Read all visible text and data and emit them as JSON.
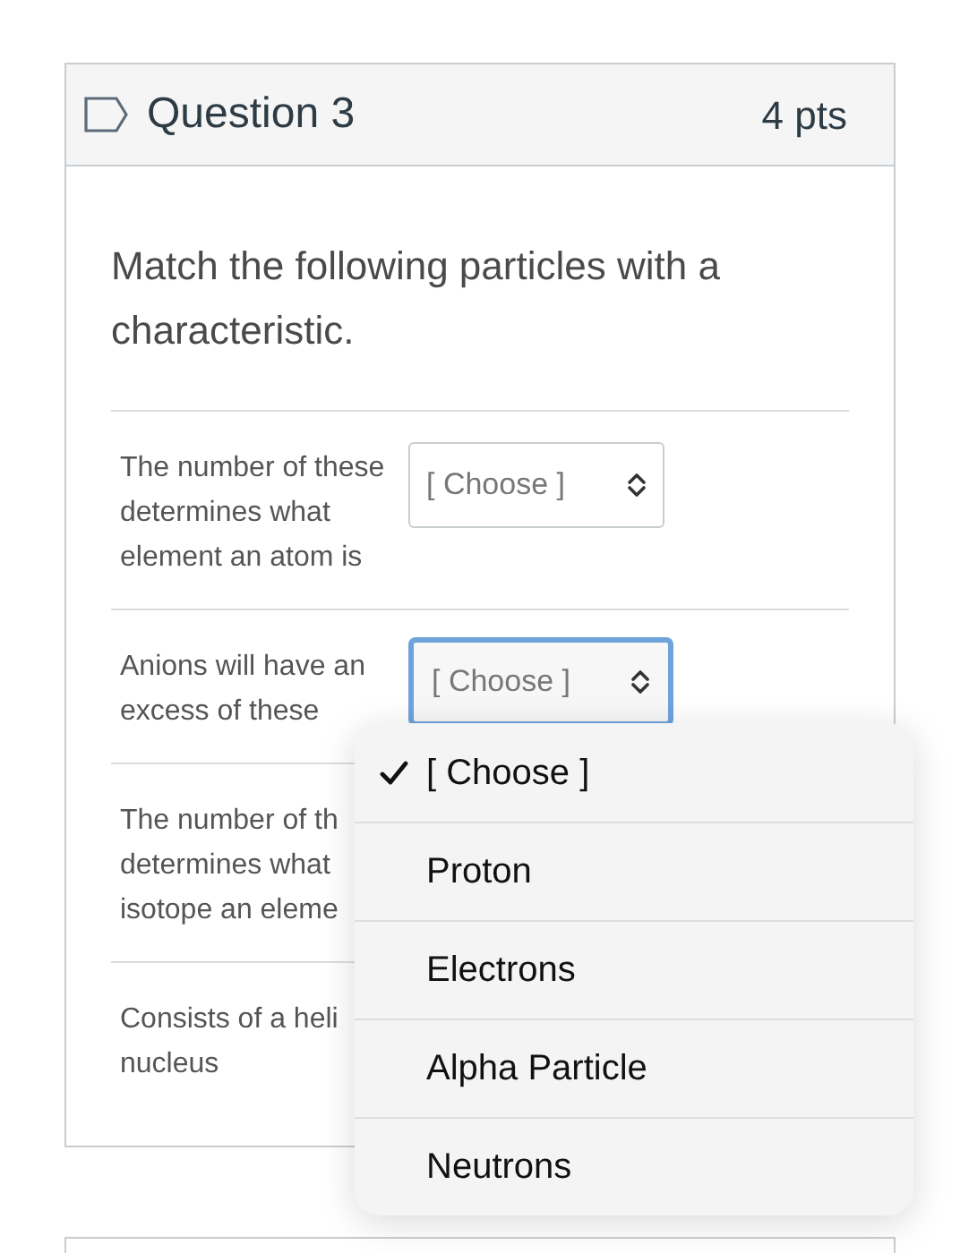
{
  "question": {
    "title": "Question 3",
    "points": "4 pts",
    "prompt": "Match the following particles with a characteristic."
  },
  "rows": [
    {
      "text": "The number of these determines what element an atom is",
      "select": {
        "value": "[ Choose ]",
        "focused": false
      }
    },
    {
      "text": "Anions will have an excess of these",
      "select": {
        "value": "[ Choose ]",
        "focused": true
      }
    },
    {
      "text": "The number of th\ndetermines what\nisotope an eleme"
    },
    {
      "text": "Consists of a heli\nnucleus"
    }
  ],
  "dropdown": {
    "options": [
      {
        "label": "[ Choose ]",
        "selected": true
      },
      {
        "label": "Proton",
        "selected": false
      },
      {
        "label": "Electrons",
        "selected": false
      },
      {
        "label": "Alpha Particle",
        "selected": false
      },
      {
        "label": "Neutrons",
        "selected": false
      }
    ]
  }
}
